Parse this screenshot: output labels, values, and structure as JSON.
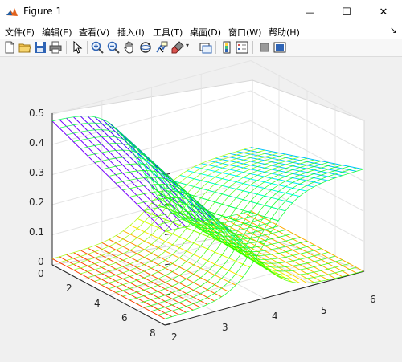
{
  "window": {
    "title": "Figure 1",
    "minimize_glyph": "—",
    "maximize_glyph": "☐",
    "close_glyph": "✕"
  },
  "menu": {
    "items": [
      "文件(F)",
      "编辑(E)",
      "查看(V)",
      "插入(I)",
      "工具(T)",
      "桌面(D)",
      "窗口(W)",
      "帮助(H)"
    ],
    "overflow_glyph": "↘"
  },
  "toolbar": {
    "icons": [
      "new-figure-icon",
      "open-file-icon",
      "save-icon",
      "print-icon",
      "pointer-icon",
      "zoom-in-icon",
      "zoom-out-icon",
      "pan-hand-icon",
      "rotate-3d-icon",
      "data-cursor-icon",
      "brush-icon",
      "link-plot-icon",
      "colorbar-icon",
      "legend-icon",
      "hide-plot-tools-icon",
      "show-plot-tools-icon"
    ]
  },
  "plot": {
    "z_ticks": [
      "0",
      "0.1",
      "0.2",
      "0.3",
      "0.4",
      "0.5"
    ],
    "y_ticks": [
      "0",
      "2",
      "4",
      "6",
      "8"
    ],
    "x_ticks": [
      "2",
      "3",
      "4",
      "5",
      "6"
    ]
  },
  "colors": {
    "accent": "#0072bd",
    "surface_palette": [
      "#ff0000",
      "#ffff00",
      "#00ff00",
      "#00ffff",
      "#0000ff",
      "#ff00ff"
    ]
  }
}
